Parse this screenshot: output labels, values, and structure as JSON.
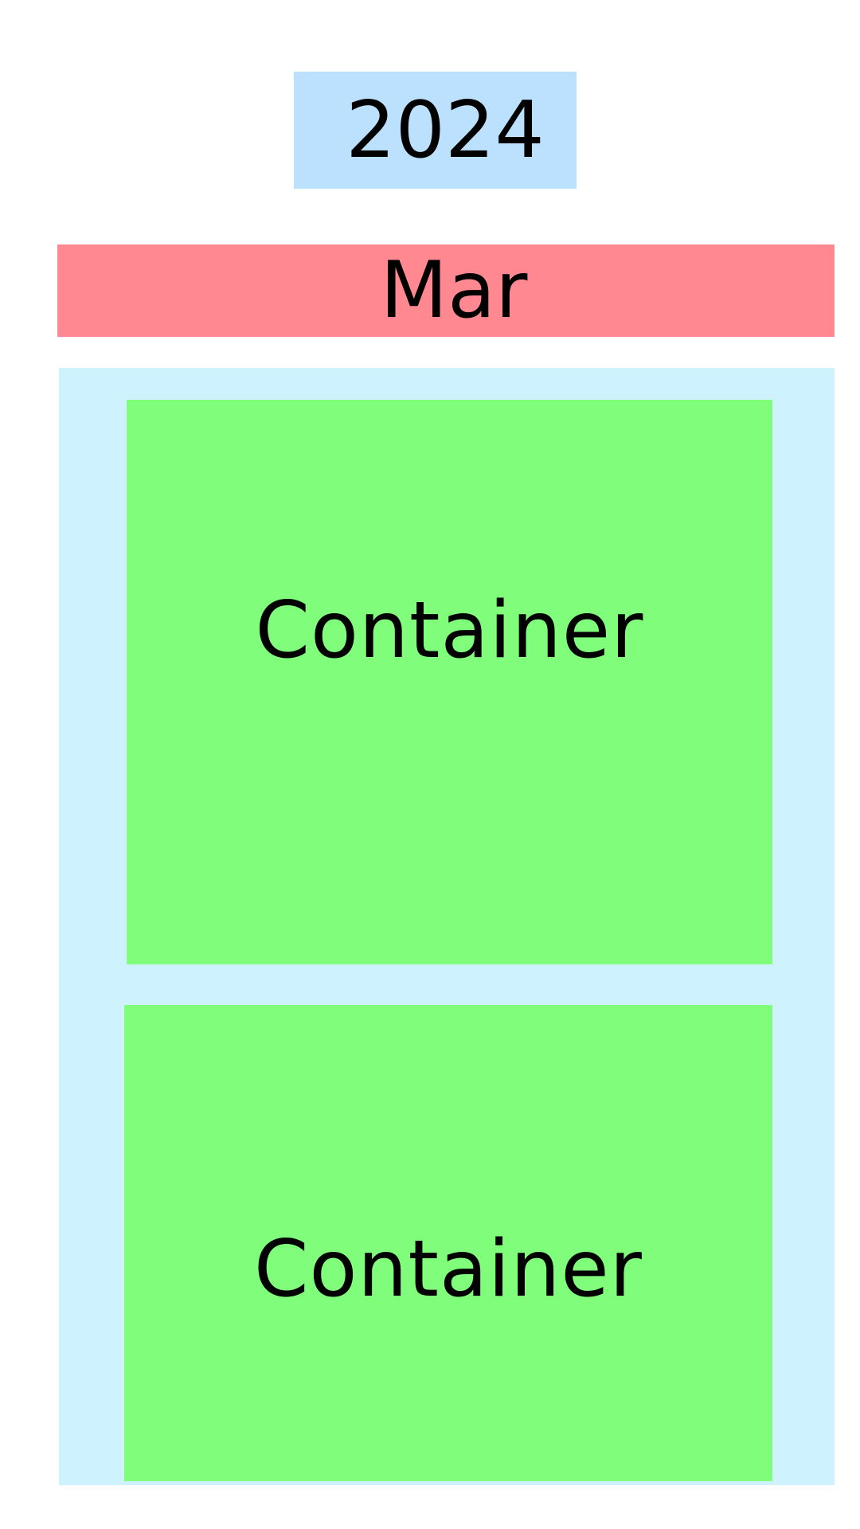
{
  "header": {
    "year": "2024",
    "month": "Mar"
  },
  "containers": [
    {
      "label": "Container"
    },
    {
      "label": "Container"
    }
  ],
  "colors": {
    "year_background": "#bbe1fe",
    "month_background": "#ff8891",
    "column_background": "#cef3fe",
    "container_background": "#80fd7a"
  }
}
